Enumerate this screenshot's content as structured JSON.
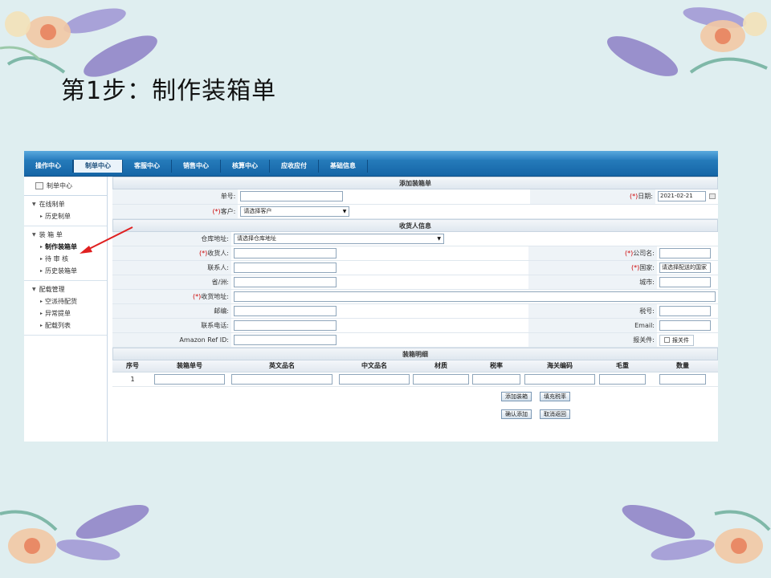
{
  "slide": {
    "title": "第1步：制作装箱单"
  },
  "app": {
    "nav_tabs": [
      "操作中心",
      "制单中心",
      "客服中心",
      "销售中心",
      "核算中心",
      "应收应付",
      "基础信息"
    ],
    "active_tab_index": 1,
    "sidebar": {
      "header": "制单中心",
      "groups": [
        {
          "title": "在线制单",
          "items": [
            "历史制单"
          ]
        },
        {
          "title": "装 箱 单",
          "items": [
            "制作装箱单",
            "待 审 核",
            "历史装箱单"
          ]
        },
        {
          "title": "配载管理",
          "items": [
            "空派待配货",
            "异常提单",
            "配载列表"
          ]
        }
      ],
      "active_item": "制作装箱单"
    },
    "form": {
      "section_title": "添加装箱单",
      "order_no_label": "单号:",
      "date_label_req": "(*)",
      "date_label": "日期:",
      "date_value": "2021-02-21",
      "customer_label_req": "(*)",
      "customer_label": "客户:",
      "customer_select": "请选择客户"
    },
    "consignee": {
      "section_title": "收货人信息",
      "warehouse_label": "仓库地址:",
      "warehouse_select": "请选择仓库地址",
      "receiver_label": "收货人:",
      "company_label": "公司名:",
      "contact_label": "联系人:",
      "country_label": "国家:",
      "country_select": "请选择配送的国家",
      "province_label": "省/洲:",
      "city_label": "城市:",
      "address_label": "收货地址:",
      "zip_label": "邮编:",
      "tax_label": "税号:",
      "phone_label": "联系电话:",
      "email_label": "Email:",
      "amazon_label": "Amazon Ref ID:",
      "customs_label": "报关件:",
      "customs_checkbox": "报关件",
      "req": "(*)"
    },
    "detail": {
      "section_title": "装箱明细",
      "columns": [
        "序号",
        "装箱单号",
        "英文品名",
        "中文品名",
        "材质",
        "税率",
        "海关编码",
        "毛重",
        "数量"
      ],
      "row_no": "1",
      "buttons": {
        "add_box": "添加装箱",
        "fill_tax": "填充税率",
        "confirm_add": "确认添加",
        "cancel_back": "取消返回"
      }
    }
  }
}
